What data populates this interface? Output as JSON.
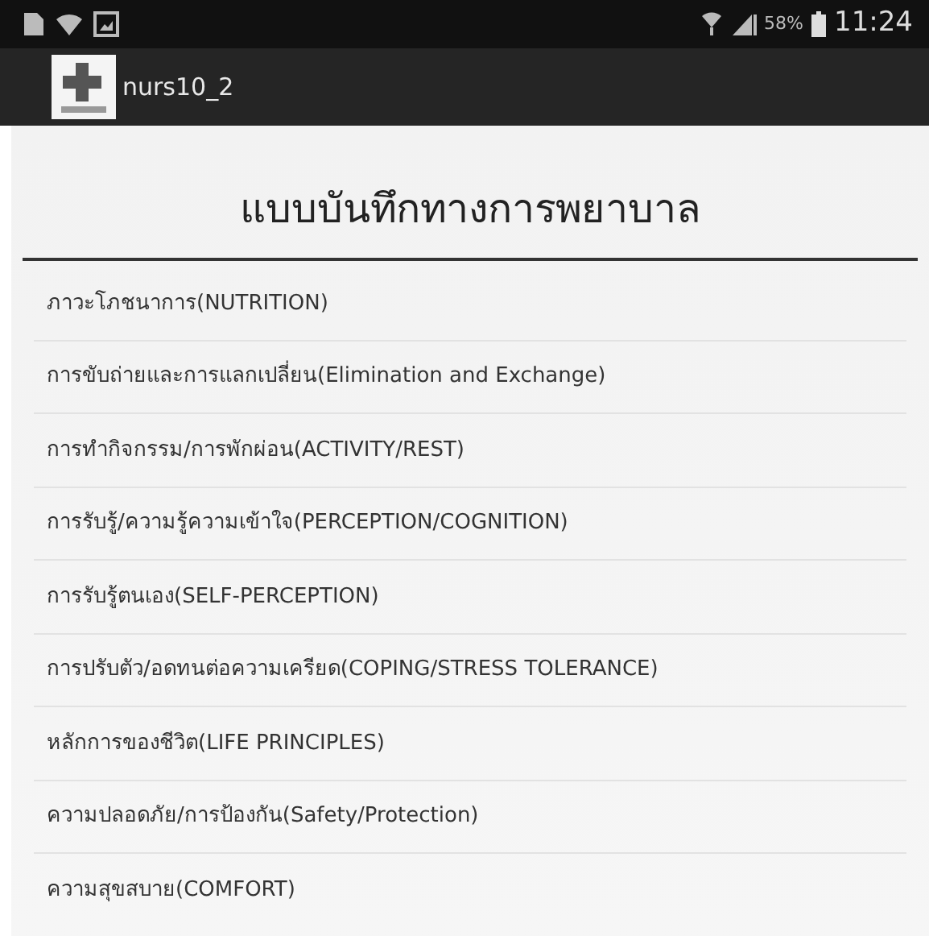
{
  "status_bar": {
    "battery": "58%",
    "time": "11:24"
  },
  "app_bar": {
    "title": "nurs10_2"
  },
  "heading": "แบบบันทึกทางการพยาบาล",
  "items": [
    {
      "label": "ภาวะโภชนาการ(NUTRITION)"
    },
    {
      "label": "การขับถ่ายและการแลกเปลี่ยน(Elimination and Exchange)"
    },
    {
      "label": "การทำกิจกรรม/การพักผ่อน(ACTIVITY/REST)"
    },
    {
      "label": "การรับรู้/ความรู้ความเข้าใจ(PERCEPTION/COGNITION)"
    },
    {
      "label": "การรับรู้ตนเอง(SELF-PERCEPTION)"
    },
    {
      "label": "การปรับตัว/อดทนต่อความเครียด(COPING/STRESS TOLERANCE)"
    },
    {
      "label": "หลักการของชีวิต(LIFE PRINCIPLES)"
    },
    {
      "label": "ความปลอดภัย/การป้องกัน(Safety/Protection)"
    },
    {
      "label": "ความสุขสบาย(COMFORT)"
    }
  ]
}
